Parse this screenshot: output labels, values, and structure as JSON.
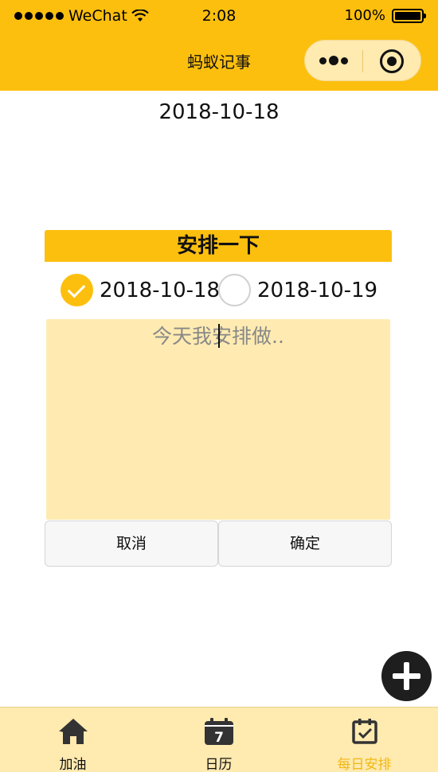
{
  "status_bar": {
    "carrier": "WeChat",
    "time": "2:08",
    "battery": "100%"
  },
  "nav": {
    "title": "蚂蚁记事"
  },
  "page": {
    "date": "2018-10-18"
  },
  "dialog": {
    "title": "安排一下",
    "options": [
      {
        "label": "2018-10-18",
        "selected": true
      },
      {
        "label": "2018-10-19",
        "selected": false
      }
    ],
    "textarea_placeholder": "今天我安排做..",
    "cancel_label": "取消",
    "confirm_label": "确定"
  },
  "tabbar": {
    "items": [
      {
        "label": "加油",
        "icon": "home-icon",
        "active": false
      },
      {
        "label": "日历",
        "icon": "calendar-icon",
        "calendar_day": "7",
        "active": false
      },
      {
        "label": "每日安排",
        "icon": "calendar-check-icon",
        "active": true
      }
    ]
  },
  "colors": {
    "accent": "#fdbf0e",
    "accent_light": "#ffeab0",
    "active_tab_text": "#f2b814"
  }
}
